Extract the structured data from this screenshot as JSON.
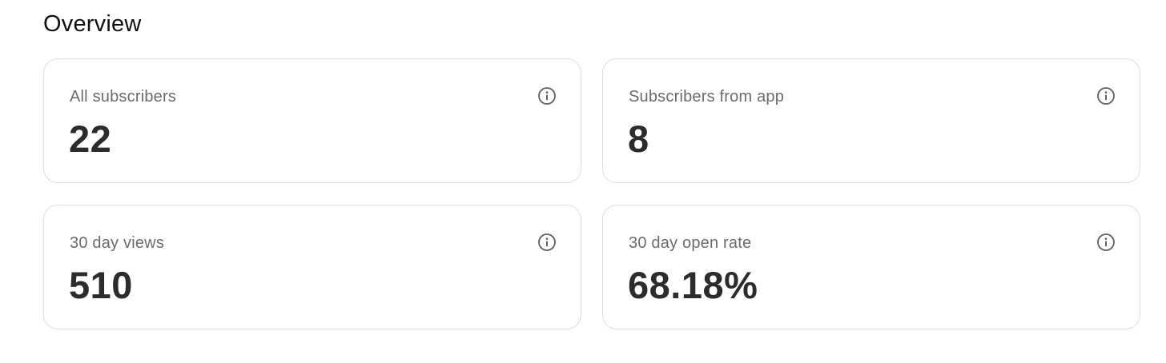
{
  "header": {
    "title": "Overview"
  },
  "cards": [
    {
      "label": "All subscribers",
      "value": "22",
      "icon": "info-icon"
    },
    {
      "label": "Subscribers from app",
      "value": "8",
      "icon": "info-icon"
    },
    {
      "label": "30 day views",
      "value": "510",
      "icon": "info-icon"
    },
    {
      "label": "30 day open rate",
      "value": "68.18%",
      "icon": "info-icon"
    }
  ]
}
